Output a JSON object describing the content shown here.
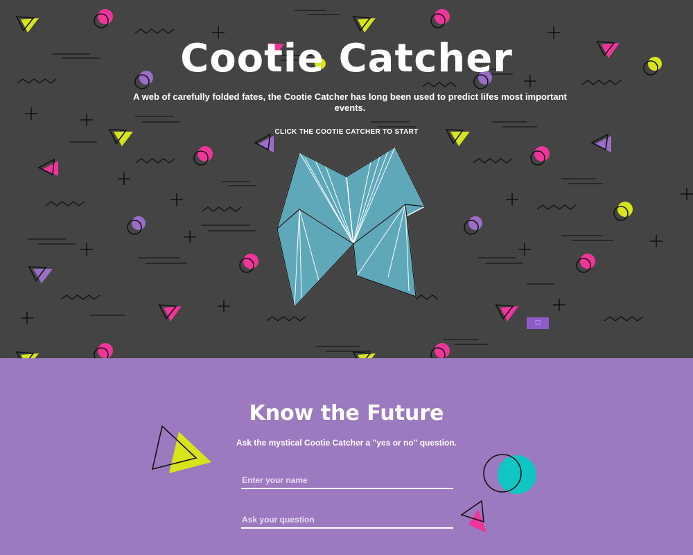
{
  "hero": {
    "title": "Cootie Catcher",
    "description": "A web of carefully folded fates, the Cootie Catcher has long been used to predict lifes most important events.",
    "cta": "CLICK THE COOTIE CATCHER TO START",
    "mini_button_glyph": "□"
  },
  "future": {
    "title": "Know the Future",
    "subtitle": "Ask the mystical Cootie Catcher a \"yes or no\" question.",
    "name_placeholder": "Enter your name",
    "question_placeholder": "Ask your question"
  },
  "colors": {
    "hero_background": "#444444",
    "future_background": "#9c7abf",
    "catcher_fill": "#5fa8ba",
    "accent_pink": "#f0359a",
    "accent_yellow": "#d7e41a",
    "accent_purple": "#9a6dc6",
    "accent_teal": "#0fc6c2"
  },
  "icons": [
    "triangle-decoration",
    "circle-decoration",
    "plus-decoration",
    "zigzag-decoration",
    "dash-decoration",
    "cootie-catcher-icon"
  ]
}
